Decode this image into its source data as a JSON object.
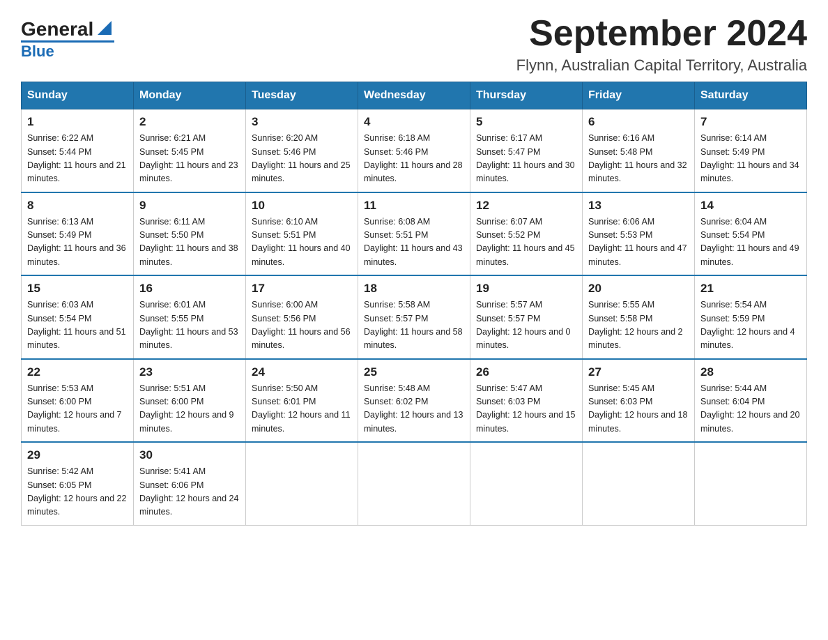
{
  "header": {
    "logo_general": "General",
    "logo_blue": "Blue",
    "title": "September 2024",
    "subtitle": "Flynn, Australian Capital Territory, Australia"
  },
  "days_of_week": [
    "Sunday",
    "Monday",
    "Tuesday",
    "Wednesday",
    "Thursday",
    "Friday",
    "Saturday"
  ],
  "weeks": [
    [
      {
        "num": "1",
        "sunrise": "6:22 AM",
        "sunset": "5:44 PM",
        "daylight": "11 hours and 21 minutes."
      },
      {
        "num": "2",
        "sunrise": "6:21 AM",
        "sunset": "5:45 PM",
        "daylight": "11 hours and 23 minutes."
      },
      {
        "num": "3",
        "sunrise": "6:20 AM",
        "sunset": "5:46 PM",
        "daylight": "11 hours and 25 minutes."
      },
      {
        "num": "4",
        "sunrise": "6:18 AM",
        "sunset": "5:46 PM",
        "daylight": "11 hours and 28 minutes."
      },
      {
        "num": "5",
        "sunrise": "6:17 AM",
        "sunset": "5:47 PM",
        "daylight": "11 hours and 30 minutes."
      },
      {
        "num": "6",
        "sunrise": "6:16 AM",
        "sunset": "5:48 PM",
        "daylight": "11 hours and 32 minutes."
      },
      {
        "num": "7",
        "sunrise": "6:14 AM",
        "sunset": "5:49 PM",
        "daylight": "11 hours and 34 minutes."
      }
    ],
    [
      {
        "num": "8",
        "sunrise": "6:13 AM",
        "sunset": "5:49 PM",
        "daylight": "11 hours and 36 minutes."
      },
      {
        "num": "9",
        "sunrise": "6:11 AM",
        "sunset": "5:50 PM",
        "daylight": "11 hours and 38 minutes."
      },
      {
        "num": "10",
        "sunrise": "6:10 AM",
        "sunset": "5:51 PM",
        "daylight": "11 hours and 40 minutes."
      },
      {
        "num": "11",
        "sunrise": "6:08 AM",
        "sunset": "5:51 PM",
        "daylight": "11 hours and 43 minutes."
      },
      {
        "num": "12",
        "sunrise": "6:07 AM",
        "sunset": "5:52 PM",
        "daylight": "11 hours and 45 minutes."
      },
      {
        "num": "13",
        "sunrise": "6:06 AM",
        "sunset": "5:53 PM",
        "daylight": "11 hours and 47 minutes."
      },
      {
        "num": "14",
        "sunrise": "6:04 AM",
        "sunset": "5:54 PM",
        "daylight": "11 hours and 49 minutes."
      }
    ],
    [
      {
        "num": "15",
        "sunrise": "6:03 AM",
        "sunset": "5:54 PM",
        "daylight": "11 hours and 51 minutes."
      },
      {
        "num": "16",
        "sunrise": "6:01 AM",
        "sunset": "5:55 PM",
        "daylight": "11 hours and 53 minutes."
      },
      {
        "num": "17",
        "sunrise": "6:00 AM",
        "sunset": "5:56 PM",
        "daylight": "11 hours and 56 minutes."
      },
      {
        "num": "18",
        "sunrise": "5:58 AM",
        "sunset": "5:57 PM",
        "daylight": "11 hours and 58 minutes."
      },
      {
        "num": "19",
        "sunrise": "5:57 AM",
        "sunset": "5:57 PM",
        "daylight": "12 hours and 0 minutes."
      },
      {
        "num": "20",
        "sunrise": "5:55 AM",
        "sunset": "5:58 PM",
        "daylight": "12 hours and 2 minutes."
      },
      {
        "num": "21",
        "sunrise": "5:54 AM",
        "sunset": "5:59 PM",
        "daylight": "12 hours and 4 minutes."
      }
    ],
    [
      {
        "num": "22",
        "sunrise": "5:53 AM",
        "sunset": "6:00 PM",
        "daylight": "12 hours and 7 minutes."
      },
      {
        "num": "23",
        "sunrise": "5:51 AM",
        "sunset": "6:00 PM",
        "daylight": "12 hours and 9 minutes."
      },
      {
        "num": "24",
        "sunrise": "5:50 AM",
        "sunset": "6:01 PM",
        "daylight": "12 hours and 11 minutes."
      },
      {
        "num": "25",
        "sunrise": "5:48 AM",
        "sunset": "6:02 PM",
        "daylight": "12 hours and 13 minutes."
      },
      {
        "num": "26",
        "sunrise": "5:47 AM",
        "sunset": "6:03 PM",
        "daylight": "12 hours and 15 minutes."
      },
      {
        "num": "27",
        "sunrise": "5:45 AM",
        "sunset": "6:03 PM",
        "daylight": "12 hours and 18 minutes."
      },
      {
        "num": "28",
        "sunrise": "5:44 AM",
        "sunset": "6:04 PM",
        "daylight": "12 hours and 20 minutes."
      }
    ],
    [
      {
        "num": "29",
        "sunrise": "5:42 AM",
        "sunset": "6:05 PM",
        "daylight": "12 hours and 22 minutes."
      },
      {
        "num": "30",
        "sunrise": "5:41 AM",
        "sunset": "6:06 PM",
        "daylight": "12 hours and 24 minutes."
      },
      null,
      null,
      null,
      null,
      null
    ]
  ]
}
